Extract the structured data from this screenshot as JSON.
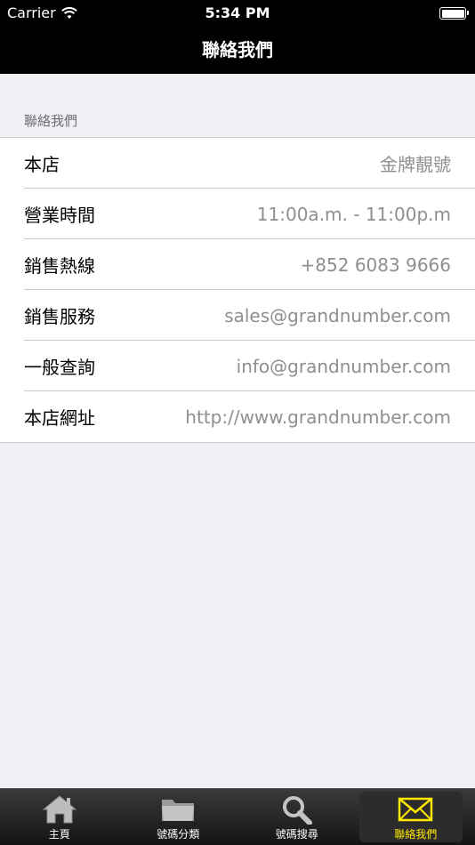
{
  "status_bar": {
    "carrier": "Carrier",
    "time": "5:34 PM"
  },
  "nav": {
    "title": "聯絡我們"
  },
  "section": {
    "header": "聯絡我們",
    "rows": [
      {
        "label": "本店",
        "value": "金牌靚號"
      },
      {
        "label": "營業時間",
        "value": "11:00a.m. - 11:00p.m"
      },
      {
        "label": "銷售熱線",
        "value": "+852 6083 9666"
      },
      {
        "label": "銷售服務",
        "value": "sales@grandnumber.com"
      },
      {
        "label": "一般查詢",
        "value": "info@grandnumber.com"
      },
      {
        "label": "本店網址",
        "value": "http://www.grandnumber.com"
      }
    ]
  },
  "tabbar": {
    "tabs": [
      {
        "label": "主頁",
        "icon": "home-icon"
      },
      {
        "label": "號碼分類",
        "icon": "folder-icon"
      },
      {
        "label": "號碼搜尋",
        "icon": "search-icon"
      },
      {
        "label": "聯絡我們",
        "icon": "envelope-icon"
      }
    ],
    "selected_index": 3,
    "selected_color": "#ffe800"
  }
}
